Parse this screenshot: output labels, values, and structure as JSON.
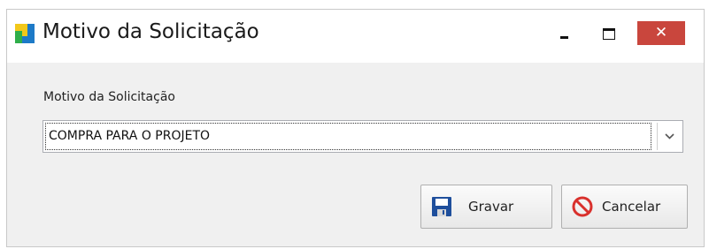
{
  "window": {
    "title": "Motivo da Solicitação",
    "controls": {
      "minimize_icon": "minimize-icon",
      "maximize_icon": "maximize-icon",
      "close_icon": "close-icon"
    }
  },
  "form": {
    "field_label": "Motivo da Solicitação",
    "combo_value": "COMPRA PARA O PROJETO",
    "combo_icon": "chevron-down-icon"
  },
  "buttons": {
    "save_label": "Gravar",
    "save_icon": "floppy-disk-icon",
    "cancel_label": "Cancelar",
    "cancel_icon": "no-entry-icon"
  },
  "colors": {
    "close_button": "#c9463d",
    "dialog_body": "#f0f0f0",
    "save_icon": "#1f4f9c",
    "cancel_icon": "#d9302c"
  }
}
